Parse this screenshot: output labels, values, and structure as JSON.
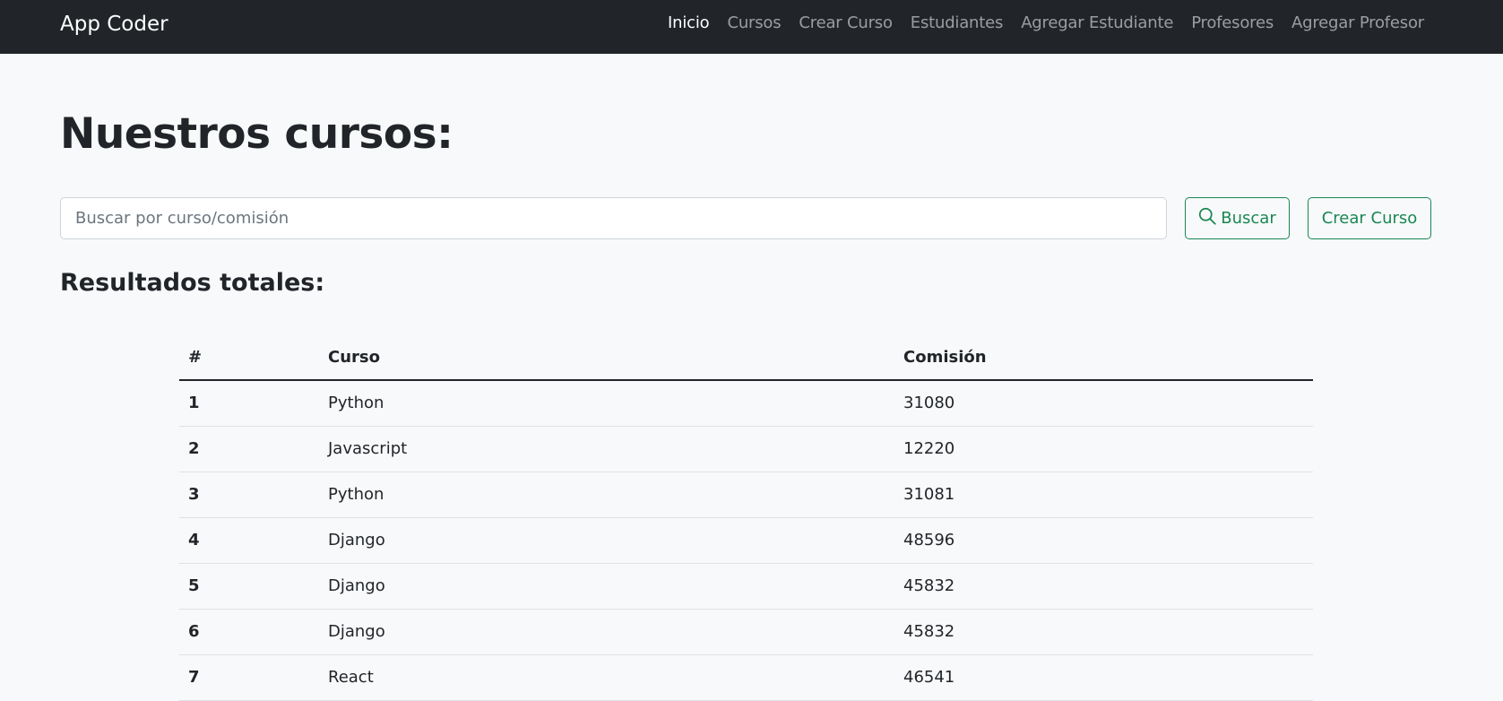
{
  "navbar": {
    "brand": "App Coder",
    "links": [
      {
        "label": "Inicio",
        "active": true
      },
      {
        "label": "Cursos",
        "active": false
      },
      {
        "label": "Crear Curso",
        "active": false
      },
      {
        "label": "Estudiantes",
        "active": false
      },
      {
        "label": "Agregar Estudiante",
        "active": false
      },
      {
        "label": "Profesores",
        "active": false
      },
      {
        "label": "Agregar Profesor",
        "active": false
      }
    ]
  },
  "main": {
    "title": "Nuestros cursos:",
    "search": {
      "placeholder": "Buscar por curso/comisión",
      "value": "",
      "button_label": "Buscar",
      "button_icon": "search-icon"
    },
    "create_button_label": "Crear Curso",
    "results_heading": "Resultados totales:",
    "table": {
      "headers": [
        "#",
        "Curso",
        "Comisión"
      ],
      "rows": [
        {
          "index": "1",
          "course": "Python",
          "commission": "31080"
        },
        {
          "index": "2",
          "course": "Javascript",
          "commission": "12220"
        },
        {
          "index": "3",
          "course": "Python",
          "commission": "31081"
        },
        {
          "index": "4",
          "course": "Django",
          "commission": "48596"
        },
        {
          "index": "5",
          "course": "Django",
          "commission": "45832"
        },
        {
          "index": "6",
          "course": "Django",
          "commission": "45832"
        },
        {
          "index": "7",
          "course": "React",
          "commission": "46541"
        }
      ]
    }
  },
  "colors": {
    "navbar_bg": "#212529",
    "page_bg": "#f8f9fa",
    "accent_green": "#198754"
  }
}
